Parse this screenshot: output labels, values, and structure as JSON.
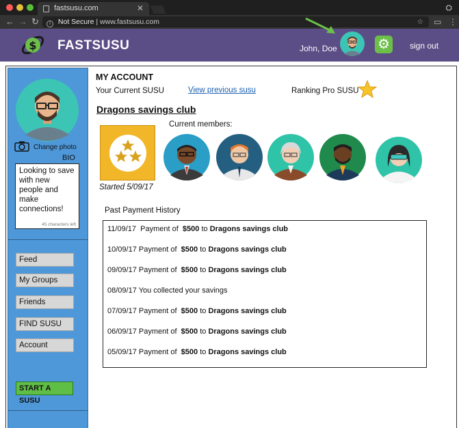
{
  "browser": {
    "tab_title": "fastsusu.com",
    "security_label": "Not Secure",
    "url": "www.fastsusu.com"
  },
  "header": {
    "brand": "FASTSUSU",
    "user_name": "John, Doe",
    "sign_out": "sign out",
    "colors": {
      "bar": "#5b4d86",
      "gear": "#6cc04a"
    }
  },
  "sidebar": {
    "change_photo": "Change photo",
    "bio_label": "BIO",
    "bio_text": "Looking to save with new people and make connections!",
    "bio_count": "45 characters left",
    "nav": [
      {
        "label": "Feed"
      },
      {
        "label": "My Groups"
      },
      {
        "label": "Friends"
      },
      {
        "label": "FIND SUSU"
      },
      {
        "label": "Account"
      }
    ],
    "start_button": "START A SUSU"
  },
  "main": {
    "heading": "MY ACCOUNT",
    "current_susu": "Your Current  SUSU",
    "view_previous": "View previous susu",
    "ranking": "Ranking Pro SUSU",
    "club_name": "Dragons savings club",
    "started": "Started 5/09/17",
    "members_label": "Current members:",
    "history_label": "Past Payment History",
    "history": [
      {
        "date": "11/09/17",
        "text": "Payment of",
        "amount": "$500",
        "to": "to",
        "club": "Dragons savings club"
      },
      {
        "date": "10/09/17",
        "text": "Payment of",
        "amount": "$500",
        "to": "to",
        "club": "Dragons savings club"
      },
      {
        "date": "09/09/17",
        "text": "Payment of",
        "amount": "$500",
        "to": "to",
        "club": "Dragons savings club"
      },
      {
        "date": "08/09/17",
        "text": "You collected your savings",
        "amount": "",
        "to": "",
        "club": ""
      },
      {
        "date": "07/09/17",
        "text": "Payment of",
        "amount": "$500",
        "to": "to",
        "club": "Dragons savings club"
      },
      {
        "date": "06/09/17",
        "text": "Payment of",
        "amount": "$500",
        "to": "to",
        "club": "Dragons savings club"
      },
      {
        "date": "05/09/17",
        "text": "Payment of",
        "amount": "$500",
        "to": "to",
        "club": "Dragons savings club"
      }
    ]
  }
}
